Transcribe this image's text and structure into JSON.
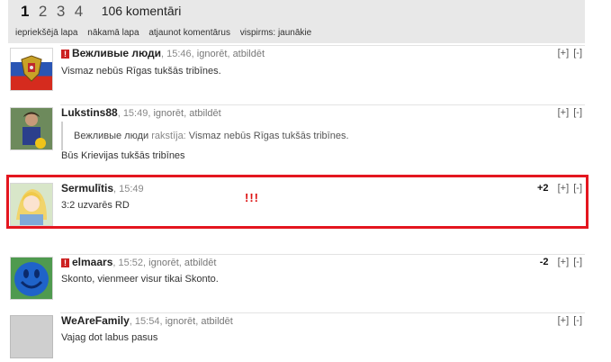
{
  "pagination": {
    "pages": [
      "1",
      "2",
      "3",
      "4"
    ],
    "current": "1",
    "count_label": "106 komentāri"
  },
  "nav": {
    "prev": "iepriekšējā lapa",
    "next": "nākamā lapa",
    "refresh": "atjaunot komentārus",
    "order": "vispirms: jaunākie"
  },
  "comments": [
    {
      "author": "Вежливые люди",
      "time": ", 15:46, ",
      "ignore": "ignorēt",
      "reply": "atbildēt",
      "score": "",
      "plus": "[+]",
      "minus": "[-]",
      "text": "Vismaz nebūs Rīgas tukšās tribīnes.",
      "avatar": "russian-coat-of-arms",
      "warn": "!"
    },
    {
      "author": "Lukstins88",
      "time": ", 15:49, ",
      "ignore": "ignorēt",
      "reply": "atbildēt",
      "score": "",
      "plus": "[+]",
      "minus": "[-]",
      "quote_author": "Вежливые люди",
      "quote_verb": " rakstīja:",
      "quote_text": " Vismaz nebūs Rīgas tukšās tribīnes.",
      "text": "Būs Krievijas tukšās tribīnes",
      "avatar": "football-player"
    },
    {
      "author": "Sermulītis",
      "time": ", 15:49",
      "score": "+2",
      "plus": "[+]",
      "minus": "[-]",
      "text": "3:2 uzvarēs RD",
      "avatar": "anime-girl",
      "marker": "!!!"
    },
    {
      "author": "elmaars",
      "time": ", 15:52, ",
      "ignore": "ignorēt",
      "reply": "atbildēt",
      "score": "-2",
      "plus": "[+]",
      "minus": "[-]",
      "text": "Skonto, vienmeer visur tikai Skonto.",
      "avatar": "blue-smiley",
      "warn": "!"
    },
    {
      "author": "WeAreFamily",
      "time": ", 15:54, ",
      "ignore": "ignorēt",
      "reply": "atbildēt",
      "score": "",
      "plus": "[+]",
      "minus": "[-]",
      "text": "Vajag dot labus pasus",
      "avatar": "default-grey"
    }
  ],
  "colors": {
    "highlight_border": "#e4161f",
    "warning_badge": "#cc2222",
    "topbar_bg": "#e8e8e8"
  }
}
